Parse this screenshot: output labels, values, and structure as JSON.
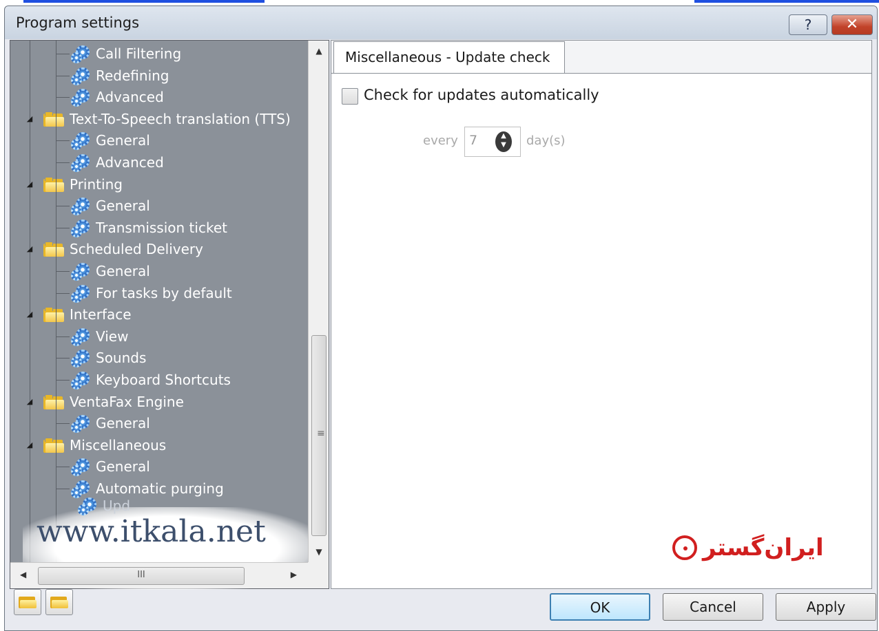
{
  "window": {
    "title": "Program settings",
    "help_glyph": "?",
    "close_glyph": "✕"
  },
  "tree": {
    "items": [
      {
        "label": "Call Filtering",
        "type": "leaf",
        "level": 2
      },
      {
        "label": "Redefining",
        "type": "leaf",
        "level": 2
      },
      {
        "label": "Advanced",
        "type": "leaf",
        "level": 2
      },
      {
        "label": "Text-To-Speech translation (TTS)",
        "type": "folder",
        "level": 1
      },
      {
        "label": "General",
        "type": "leaf",
        "level": 2
      },
      {
        "label": "Advanced",
        "type": "leaf",
        "level": 2
      },
      {
        "label": "Printing",
        "type": "folder",
        "level": 1
      },
      {
        "label": "General",
        "type": "leaf",
        "level": 2
      },
      {
        "label": "Transmission ticket",
        "type": "leaf",
        "level": 2
      },
      {
        "label": "Scheduled Delivery",
        "type": "folder",
        "level": 1
      },
      {
        "label": "General",
        "type": "leaf",
        "level": 2
      },
      {
        "label": "For tasks by default",
        "type": "leaf",
        "level": 2
      },
      {
        "label": "Interface",
        "type": "folder",
        "level": 1
      },
      {
        "label": "View",
        "type": "leaf",
        "level": 2
      },
      {
        "label": "Sounds",
        "type": "leaf",
        "level": 2
      },
      {
        "label": "Keyboard Shortcuts",
        "type": "leaf",
        "level": 2
      },
      {
        "label": "VentaFax Engine",
        "type": "folder",
        "level": 1
      },
      {
        "label": "General",
        "type": "leaf",
        "level": 2
      },
      {
        "label": "Miscellaneous",
        "type": "folder",
        "level": 1
      },
      {
        "label": "General",
        "type": "leaf",
        "level": 2
      },
      {
        "label": "Automatic purging",
        "type": "leaf",
        "level": 2
      }
    ],
    "partial_item": "Upd",
    "watermark": "www.itkala.net",
    "hscroll_grip": "III"
  },
  "panel": {
    "tab_label": "Miscellaneous - Update check",
    "checkbox_label": "Check for updates automatically",
    "checkbox_checked": false,
    "every_label": "every",
    "interval_value": "7",
    "days_label": "day(s)",
    "logo_text": "ایران‌گستر"
  },
  "buttons": {
    "ok": "OK",
    "cancel": "Cancel",
    "apply": "Apply"
  }
}
